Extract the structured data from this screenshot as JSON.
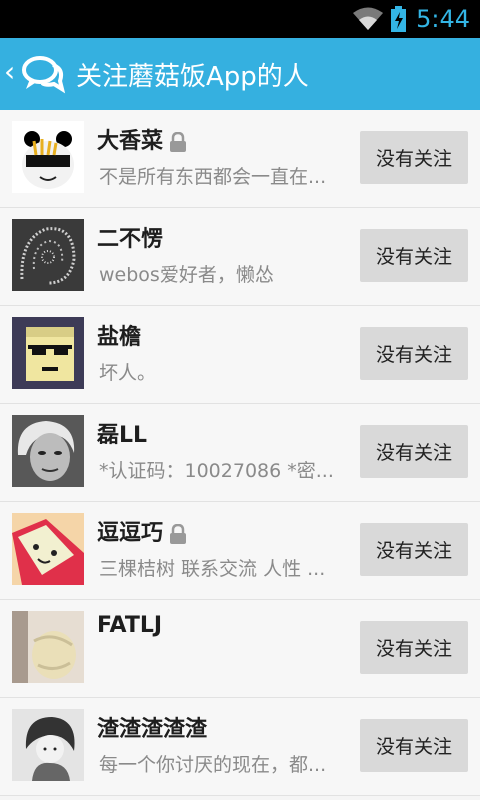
{
  "status_bar": {
    "time": "5:44",
    "wifi_icon": "wifi-icon",
    "battery_icon": "battery-charging-icon"
  },
  "action_bar": {
    "back_icon": "‹",
    "title": "关注蘑菇饭App的人"
  },
  "users": [
    {
      "name": "大香菜",
      "locked": true,
      "description": "不是所有东西都会一直在...",
      "button": "没有关注"
    },
    {
      "name": "二不愣",
      "locked": false,
      "description": "webos爱好者，懒怂",
      "button": "没有关注"
    },
    {
      "name": "盐檐",
      "locked": false,
      "description": "坏人。",
      "button": "没有关注"
    },
    {
      "name": "磊LL",
      "locked": false,
      "description": "*认证码：10027086 *密...",
      "button": "没有关注"
    },
    {
      "name": "逗逗巧",
      "locked": true,
      "description": "三棵桔树 联系交流 人性 ...",
      "button": "没有关注"
    },
    {
      "name": "FATLJ",
      "locked": false,
      "description": "",
      "button": "没有关注"
    },
    {
      "name": "渣渣渣渣渣",
      "locked": false,
      "description": "每一个你讨厌的现在，都...",
      "button": "没有关注"
    }
  ]
}
